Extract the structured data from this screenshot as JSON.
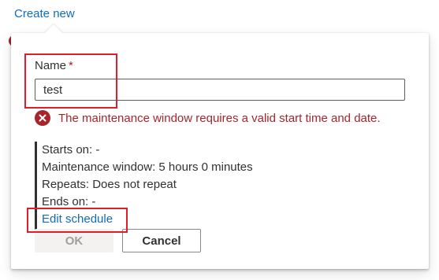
{
  "create_link": "Create new",
  "form": {
    "name_label": "Name",
    "required_marker": "*",
    "name_value": "test",
    "error_message": "The maintenance window requires a valid start time and date.",
    "error_icon": "error-circle-x-icon"
  },
  "schedule": {
    "starts_on": "Starts on: -",
    "maintenance_window": "Maintenance window: 5 hours 0 minutes",
    "repeats": "Repeats: Does not repeat",
    "ends_on": "Ends on: -",
    "edit_link": "Edit schedule"
  },
  "buttons": {
    "ok_label": "OK",
    "cancel_label": "Cancel"
  },
  "colors": {
    "link": "#0f6cbd",
    "error": "#a4262c",
    "highlight": "#e01e2b"
  }
}
